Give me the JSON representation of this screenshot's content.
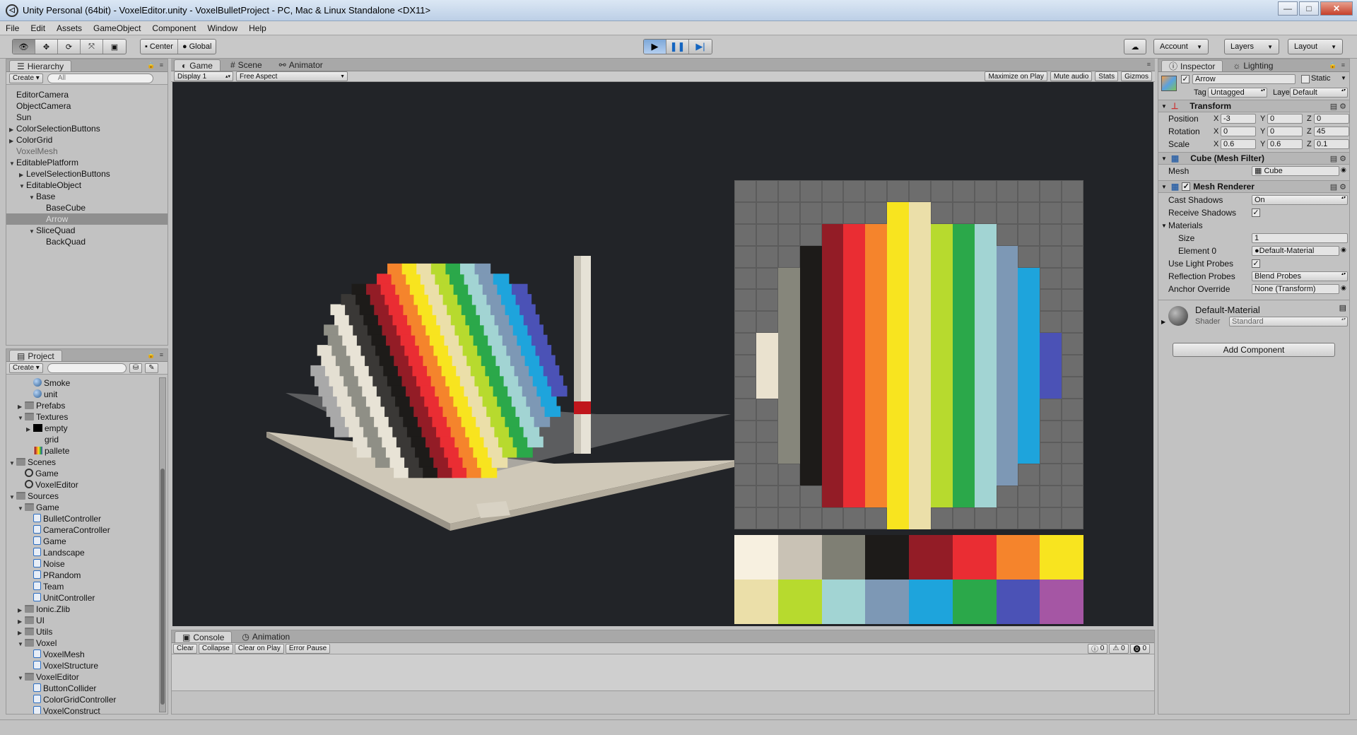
{
  "window": {
    "title": "Unity Personal (64bit) - VoxelEditor.unity - VoxelBulletProject - PC, Mac & Linux Standalone <DX11>"
  },
  "menu": [
    "File",
    "Edit",
    "Assets",
    "GameObject",
    "Component",
    "Window",
    "Help"
  ],
  "toolbar": {
    "center": "Center",
    "global": "Global",
    "account": "Account",
    "layers": "Layers",
    "layout": "Layout"
  },
  "hierarchy": {
    "tab": "Hierarchy",
    "create": "Create",
    "search_placeholder": "All",
    "items": [
      {
        "label": "EditorCamera",
        "depth": 0
      },
      {
        "label": "ObjectCamera",
        "depth": 0
      },
      {
        "label": "Sun",
        "depth": 0
      },
      {
        "label": "ColorSelectionButtons",
        "depth": 0,
        "arrow": "right"
      },
      {
        "label": "ColorGrid",
        "depth": 0,
        "arrow": "right"
      },
      {
        "label": "VoxelMesh",
        "depth": 0,
        "disabled": true
      },
      {
        "label": "EditablePlatform",
        "depth": 0,
        "arrow": "down"
      },
      {
        "label": "LevelSelectionButtons",
        "depth": 1,
        "arrow": "right"
      },
      {
        "label": "EditableObject",
        "depth": 1,
        "arrow": "down"
      },
      {
        "label": "Base",
        "depth": 2,
        "arrow": "down"
      },
      {
        "label": "BaseCube",
        "depth": 3
      },
      {
        "label": "Arrow",
        "depth": 3,
        "selected": true
      },
      {
        "label": "SliceQuad",
        "depth": 2,
        "arrow": "down"
      },
      {
        "label": "BackQuad",
        "depth": 3
      }
    ]
  },
  "project": {
    "tab": "Project",
    "create": "Create",
    "items": [
      {
        "label": "Smoke",
        "depth": 2,
        "icon": "sphere"
      },
      {
        "label": "unit",
        "depth": 2,
        "icon": "sphere"
      },
      {
        "label": "Prefabs",
        "depth": 1,
        "icon": "folder",
        "arrow": "right"
      },
      {
        "label": "Textures",
        "depth": 1,
        "icon": "folder",
        "arrow": "down"
      },
      {
        "label": "empty",
        "depth": 2,
        "icon": "black",
        "arrow": "right"
      },
      {
        "label": "grid",
        "depth": 2,
        "icon": "none"
      },
      {
        "label": "pallete",
        "depth": 2,
        "icon": "pal"
      },
      {
        "label": "Scenes",
        "depth": 0,
        "icon": "folder",
        "arrow": "down"
      },
      {
        "label": "Game",
        "depth": 1,
        "icon": "scene"
      },
      {
        "label": "VoxelEditor",
        "depth": 1,
        "icon": "scene"
      },
      {
        "label": "Sources",
        "depth": 0,
        "icon": "folder",
        "arrow": "down"
      },
      {
        "label": "Game",
        "depth": 1,
        "icon": "folder",
        "arrow": "down"
      },
      {
        "label": "BulletController",
        "depth": 2,
        "icon": "script"
      },
      {
        "label": "CameraController",
        "depth": 2,
        "icon": "script"
      },
      {
        "label": "Game",
        "depth": 2,
        "icon": "script"
      },
      {
        "label": "Landscape",
        "depth": 2,
        "icon": "script"
      },
      {
        "label": "Noise",
        "depth": 2,
        "icon": "script"
      },
      {
        "label": "PRandom",
        "depth": 2,
        "icon": "script"
      },
      {
        "label": "Team",
        "depth": 2,
        "icon": "script"
      },
      {
        "label": "UnitController",
        "depth": 2,
        "icon": "script"
      },
      {
        "label": "Ionic.Zlib",
        "depth": 1,
        "icon": "folder",
        "arrow": "right"
      },
      {
        "label": "UI",
        "depth": 1,
        "icon": "folder",
        "arrow": "right"
      },
      {
        "label": "Utils",
        "depth": 1,
        "icon": "folder",
        "arrow": "right"
      },
      {
        "label": "Voxel",
        "depth": 1,
        "icon": "folder",
        "arrow": "down"
      },
      {
        "label": "VoxelMesh",
        "depth": 2,
        "icon": "script"
      },
      {
        "label": "VoxelStructure",
        "depth": 2,
        "icon": "script"
      },
      {
        "label": "VoxelEditor",
        "depth": 1,
        "icon": "folder",
        "arrow": "down"
      },
      {
        "label": "ButtonCollider",
        "depth": 2,
        "icon": "script"
      },
      {
        "label": "ColorGridController",
        "depth": 2,
        "icon": "script"
      },
      {
        "label": "VoxelConstruct",
        "depth": 2,
        "icon": "script"
      }
    ]
  },
  "center": {
    "tabs": [
      "Game",
      "Scene",
      "Animator"
    ],
    "display": "Display 1",
    "aspect": "Free Aspect",
    "right_buttons": [
      "Maximize on Play",
      "Mute audio",
      "Stats",
      "Gizmos"
    ]
  },
  "palette": {
    "top": [
      "#f7f0e0",
      "#c9c2b5",
      "#7f7f74",
      "#1d1b19",
      "#931c26",
      "#ea2d33",
      "#f5842c",
      "#f8e41f"
    ],
    "bottom": [
      "#ebdfa9",
      "#b7da2e",
      "#a2d4d3",
      "#7d98b5",
      "#1ea4dc",
      "#2ba84a",
      "#4b52b6",
      "#a556a4"
    ]
  },
  "grid_stripes": [
    {
      "color": "#eae2cf",
      "rows": [
        7,
        9
      ]
    },
    {
      "color": "#86867b",
      "rows": [
        4,
        12
      ]
    },
    {
      "color": "#1d1b19",
      "rows": [
        3,
        13
      ]
    },
    {
      "color": "#931c26",
      "rows": [
        2,
        14
      ]
    },
    {
      "color": "#ea2d33",
      "rows": [
        2,
        14
      ]
    },
    {
      "color": "#f5842c",
      "rows": [
        2,
        14
      ]
    },
    {
      "color": "#f8e41f",
      "rows": [
        1,
        15
      ]
    },
    {
      "color": "#ebdfa9",
      "rows": [
        1,
        15
      ]
    },
    {
      "color": "#b7da2e",
      "rows": [
        2,
        14
      ]
    },
    {
      "color": "#2ba84a",
      "rows": [
        2,
        14
      ]
    },
    {
      "color": "#a2d4d3",
      "rows": [
        2,
        14
      ]
    },
    {
      "color": "#7d98b5",
      "rows": [
        3,
        13
      ]
    },
    {
      "color": "#1ea4dc",
      "rows": [
        4,
        12
      ]
    },
    {
      "color": "#4b52b6",
      "rows": [
        7,
        9
      ]
    }
  ],
  "inspector": {
    "tabs": [
      "Inspector",
      "Lighting"
    ],
    "object_name": "Arrow",
    "static": "Static",
    "tag_label": "Tag",
    "tag": "Untagged",
    "layer_label": "Layer",
    "layer": "Default",
    "transform": {
      "title": "Transform",
      "position": {
        "label": "Position",
        "x": "-3",
        "y": "0",
        "z": "0"
      },
      "rotation": {
        "label": "Rotation",
        "x": "0",
        "y": "0",
        "z": "45"
      },
      "scale": {
        "label": "Scale",
        "x": "0.6",
        "y": "0.6",
        "z": "0.1"
      }
    },
    "mesh_filter": {
      "title": "Cube (Mesh Filter)",
      "mesh_label": "Mesh",
      "mesh": "Cube"
    },
    "mesh_renderer": {
      "title": "Mesh Renderer",
      "cast_shadows_label": "Cast Shadows",
      "cast_shadows": "On",
      "receive_shadows_label": "Receive Shadows",
      "materials_label": "Materials",
      "size_label": "Size",
      "size": "1",
      "element0_label": "Element 0",
      "element0": "Default-Material",
      "light_probes_label": "Use Light Probes",
      "reflection_probes_label": "Reflection Probes",
      "reflection_probes": "Blend Probes",
      "anchor_label": "Anchor Override",
      "anchor": "None (Transform)"
    },
    "material": {
      "name": "Default-Material",
      "shader_label": "Shader",
      "shader": "Standard"
    },
    "add_component": "Add Component",
    "axis": {
      "x": "X",
      "y": "Y",
      "z": "Z"
    }
  },
  "console": {
    "tabs": [
      "Console",
      "Animation"
    ],
    "buttons": [
      "Clear",
      "Collapse",
      "Clear on Play",
      "Error Pause"
    ],
    "counts": [
      "0",
      "0",
      "0"
    ]
  }
}
